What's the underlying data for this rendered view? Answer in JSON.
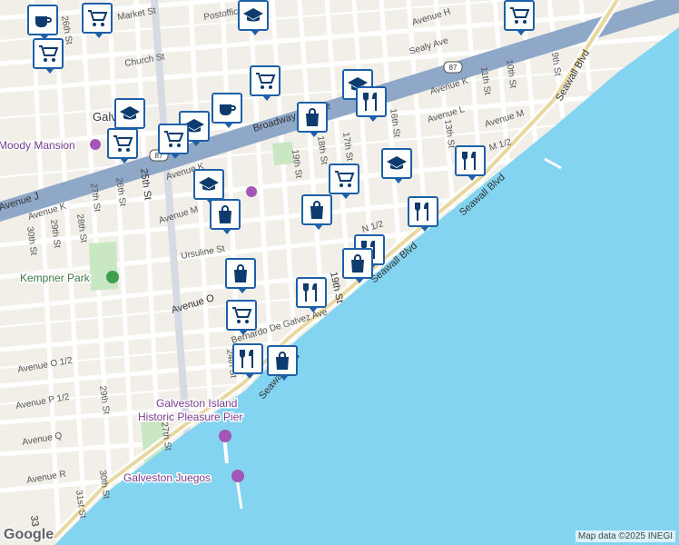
{
  "map": {
    "water_color": "#82d4f0",
    "land_color": "#f2efe9",
    "park_color": "#c9e7c2",
    "highway_color": "#8fa8c8"
  },
  "labels": {
    "city": "Galveston",
    "moody_mansion": "Moody Mansion",
    "kempner_park": "Kempner Park",
    "pleasure_pier_1": "Galveston Island",
    "pleasure_pier_2": "Historic Pleasure Pier",
    "juegos": "Galveston Juegos",
    "broadway": "Broadway Avenue",
    "seawall_1": "Seawall Blvd",
    "seawall_2": "Seawall Blvd",
    "seawall_3": "Seawall Blvd",
    "seawall_4": "Seawall Blvd",
    "seawall_5": "Seawall Blvd",
    "bernardo": "Bernardo De Galvez Ave",
    "avenue_o": "Avenue O",
    "avenue_o_half": "Avenue O 1/2",
    "avenue_p_half": "Avenue P 1/2",
    "avenue_q": "Avenue Q",
    "avenue_r": "Avenue R",
    "avenue_h": "Avenue H",
    "sealy": "Sealy Ave",
    "avenue_k_right": "Avenue K",
    "avenue_l": "Avenue L",
    "avenue_m": "Avenue M",
    "avenue_m_half": "M 1/2",
    "avenue_n_half": "N 1/2",
    "avenue_j": "Avenue J",
    "avenue_k_left": "Avenue K",
    "avenue_k_mid": "Avenue K",
    "avenue_m_left": "Avenue M",
    "ursuline": "Ursuline St",
    "church": "Church St",
    "market": "Market St",
    "postoffice": "Postoffice",
    "st_26_top": "26th St",
    "st_25": "25th St",
    "st_27": "27th St",
    "st_26": "26th St",
    "st_28": "28th St",
    "st_29": "29th St",
    "st_30": "30th St",
    "st_19": "19th St",
    "st_18": "18th St",
    "st_17": "17th St",
    "st_16": "16th St",
    "st_13": "13th St",
    "st_11": "11th St",
    "st_10": "10th St",
    "st_9": "9th St",
    "st_19_lower": "19th St",
    "st_24": "24th St",
    "st_29_lower": "29th St",
    "st_27_lower": "27th St",
    "st_30_lower": "30th St",
    "st_31": "31st St",
    "st_33": "33",
    "hwy_87": "87",
    "hwy_87b": "87"
  },
  "markers": [
    {
      "id": "m1",
      "icon": "coffee-icon"
    },
    {
      "id": "m2",
      "icon": "cart-icon"
    },
    {
      "id": "m3",
      "icon": "school-icon"
    },
    {
      "id": "m4",
      "icon": "cart-icon"
    },
    {
      "id": "m5",
      "icon": "cart-icon"
    },
    {
      "id": "m6",
      "icon": "cart-icon"
    },
    {
      "id": "m7",
      "icon": "school-icon"
    },
    {
      "id": "m8",
      "icon": "restaurant-icon"
    },
    {
      "id": "m9",
      "icon": "school-icon"
    },
    {
      "id": "m10",
      "icon": "coffee-icon"
    },
    {
      "id": "m11",
      "icon": "school-icon"
    },
    {
      "id": "m12",
      "icon": "cart-icon"
    },
    {
      "id": "m13",
      "icon": "cart-icon"
    },
    {
      "id": "m14",
      "icon": "bag-icon"
    },
    {
      "id": "m15",
      "icon": "cart-icon"
    },
    {
      "id": "m16",
      "icon": "school-icon"
    },
    {
      "id": "m17",
      "icon": "restaurant-icon"
    },
    {
      "id": "m18",
      "icon": "school-icon"
    },
    {
      "id": "m19",
      "icon": "bag-icon"
    },
    {
      "id": "m20",
      "icon": "bag-icon"
    },
    {
      "id": "m21",
      "icon": "restaurant-icon"
    },
    {
      "id": "m22",
      "icon": "restaurant-icon"
    },
    {
      "id": "m23",
      "icon": "bag-icon"
    },
    {
      "id": "m24",
      "icon": "bag-icon"
    },
    {
      "id": "m25",
      "icon": "restaurant-icon"
    },
    {
      "id": "m26",
      "icon": "cart-icon"
    },
    {
      "id": "m27",
      "icon": "restaurant-icon"
    },
    {
      "id": "m28",
      "icon": "bag-icon"
    }
  ],
  "attribution": "Map data ©2025 INEGI",
  "logo": "Google"
}
